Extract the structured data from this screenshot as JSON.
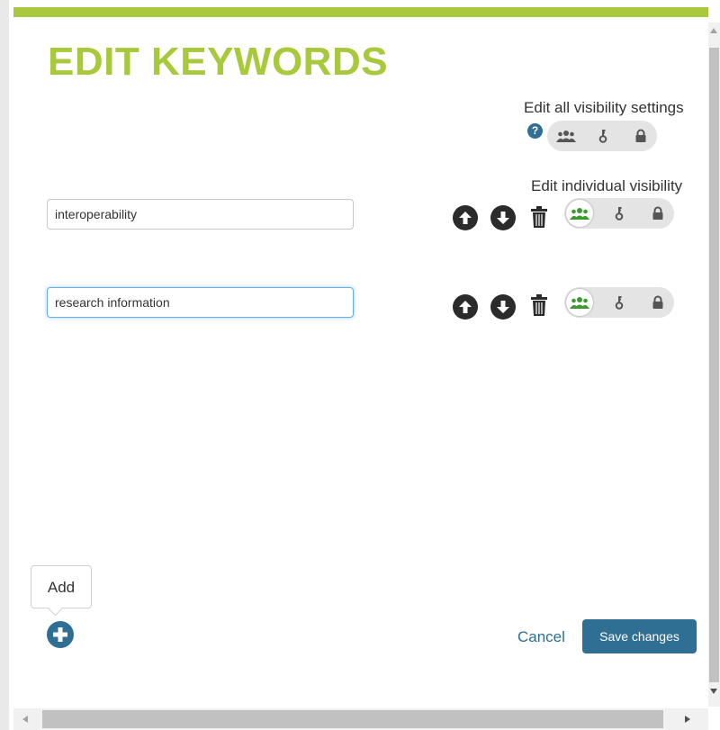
{
  "dialog": {
    "title": "EDIT KEYWORDS"
  },
  "visibility": {
    "all_label": "Edit all visibility settings",
    "individual_label": "Edit individual visibility",
    "help_glyph": "?"
  },
  "keywords": [
    {
      "value": "interoperability",
      "visibility": "public"
    },
    {
      "value": "research information",
      "visibility": "public"
    }
  ],
  "add": {
    "tooltip": "Add"
  },
  "footer": {
    "cancel_label": "Cancel",
    "save_label": "Save changes"
  },
  "colors": {
    "accent_green": "#a8c93c",
    "primary_blue": "#2f6f93",
    "active_visibility_green": "#3a9a2e"
  },
  "icons": [
    "help-icon",
    "group-icon",
    "key-icon",
    "lock-icon",
    "arrow-up-icon",
    "arrow-down-icon",
    "trash-icon",
    "plus-icon"
  ]
}
